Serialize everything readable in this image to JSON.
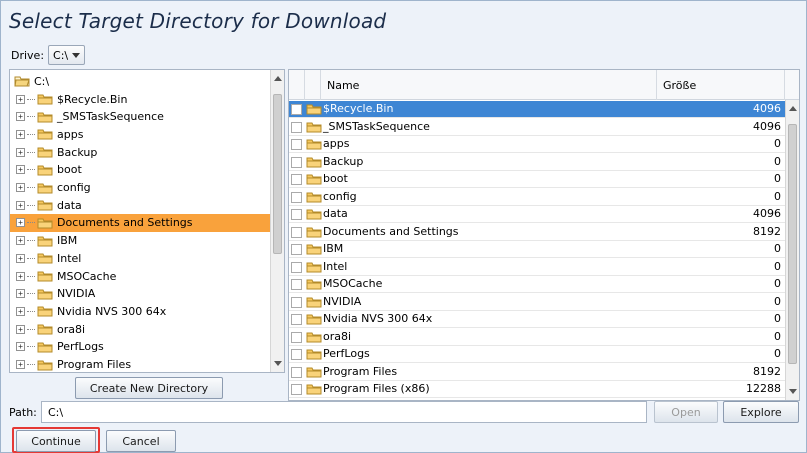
{
  "window": {
    "title": "Select Target Directory for Download"
  },
  "drive": {
    "label": "Drive:",
    "value": "C:\\"
  },
  "tree": {
    "root": "C:\\",
    "items": [
      {
        "label": "$Recycle.Bin"
      },
      {
        "label": "_SMSTaskSequence"
      },
      {
        "label": "apps"
      },
      {
        "label": "Backup"
      },
      {
        "label": "boot"
      },
      {
        "label": "config"
      },
      {
        "label": "data"
      },
      {
        "label": "Documents and Settings",
        "selected": true
      },
      {
        "label": "IBM"
      },
      {
        "label": "Intel"
      },
      {
        "label": "MSOCache"
      },
      {
        "label": "NVIDIA"
      },
      {
        "label": "Nvidia NVS 300 64x"
      },
      {
        "label": "ora8i"
      },
      {
        "label": "PerfLogs"
      },
      {
        "label": "Program Files"
      }
    ]
  },
  "table": {
    "columns": {
      "name": "Name",
      "size": "Größe"
    },
    "rows": [
      {
        "name": "$Recycle.Bin",
        "size": "4096",
        "selected": true
      },
      {
        "name": "_SMSTaskSequence",
        "size": "4096"
      },
      {
        "name": "apps",
        "size": "0"
      },
      {
        "name": "Backup",
        "size": "0"
      },
      {
        "name": "boot",
        "size": "0"
      },
      {
        "name": "config",
        "size": "0"
      },
      {
        "name": "data",
        "size": "4096"
      },
      {
        "name": "Documents and Settings",
        "size": "8192"
      },
      {
        "name": "IBM",
        "size": "0"
      },
      {
        "name": "Intel",
        "size": "0"
      },
      {
        "name": "MSOCache",
        "size": "0"
      },
      {
        "name": "NVIDIA",
        "size": "0"
      },
      {
        "name": "Nvidia NVS 300 64x",
        "size": "0"
      },
      {
        "name": "ora8i",
        "size": "0"
      },
      {
        "name": "PerfLogs",
        "size": "0"
      },
      {
        "name": "Program Files",
        "size": "8192"
      },
      {
        "name": "Program Files (x86)",
        "size": "12288"
      }
    ]
  },
  "buttons": {
    "create_dir": "Create New Directory",
    "open": "Open",
    "explore": "Explore",
    "continue": "Continue",
    "cancel": "Cancel"
  },
  "path": {
    "label": "Path:",
    "value": "C:\\"
  },
  "colors": {
    "tree_selection": "#f9a23c",
    "table_selection": "#3e86d4",
    "continue_highlight": "#e53935",
    "folder": "#f6c85f"
  }
}
